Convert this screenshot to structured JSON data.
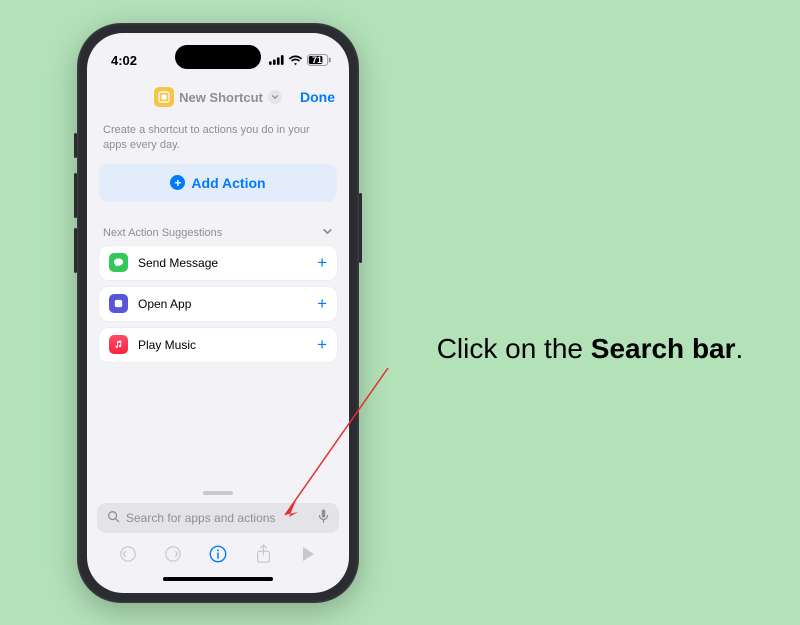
{
  "status": {
    "time": "4:02",
    "battery": "71"
  },
  "nav": {
    "title": "New Shortcut",
    "done": "Done"
  },
  "hint": "Create a shortcut to actions you do in your apps every day.",
  "add_action": "Add Action",
  "suggestions": {
    "header": "Next Action Suggestions",
    "items": [
      {
        "label": "Send Message",
        "icon": "message-icon"
      },
      {
        "label": "Open App",
        "icon": "open-app-icon"
      },
      {
        "label": "Play Music",
        "icon": "music-icon"
      }
    ]
  },
  "search": {
    "placeholder": "Search for apps and actions"
  },
  "annotation": {
    "prefix": "Click on the ",
    "bold": "Search bar",
    "suffix": "."
  }
}
